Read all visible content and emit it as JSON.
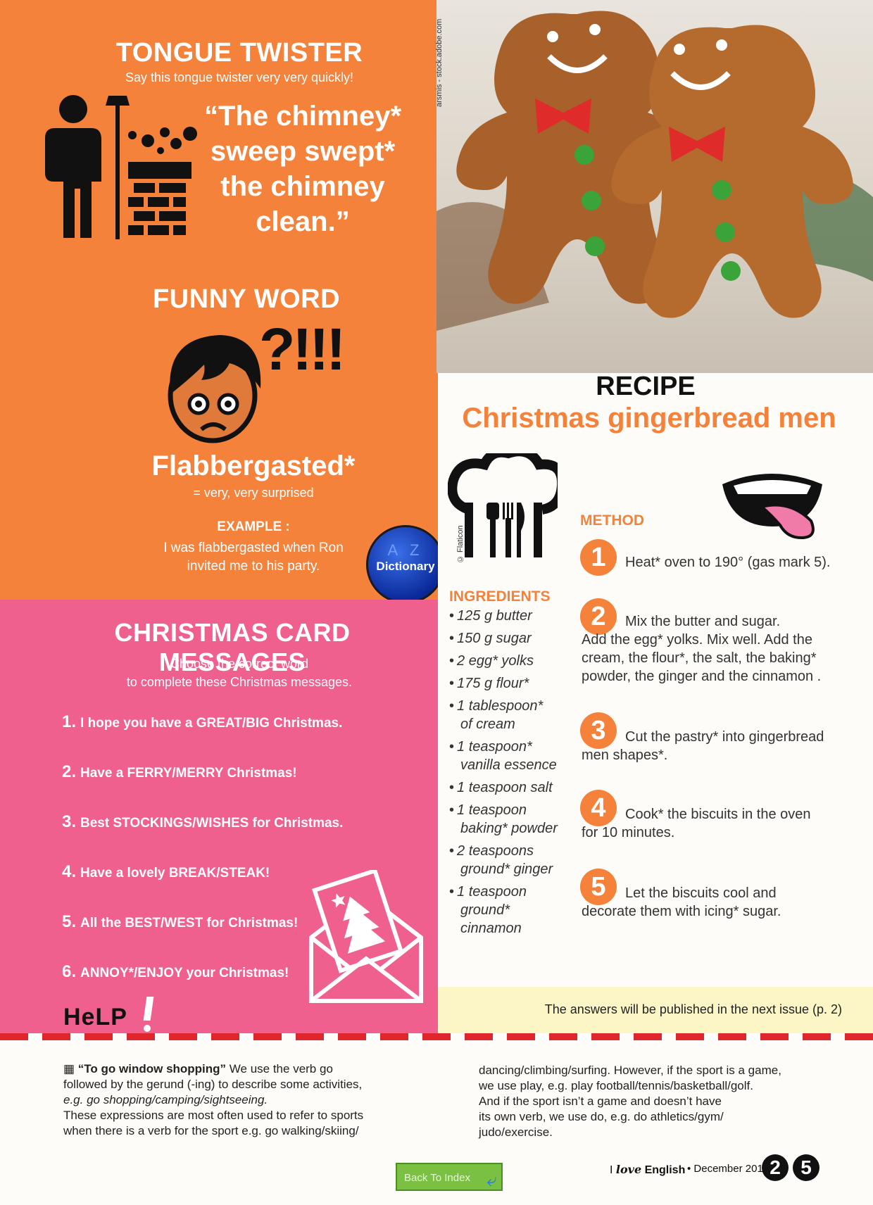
{
  "tongue_twister": {
    "title": "TONGUE TWISTER",
    "subtitle": "Say this tongue twister very very quickly!",
    "lines": [
      "“The chimney*",
      "sweep swept*",
      "the chimney",
      "clean.”"
    ]
  },
  "funny_word": {
    "title": "FUNNY WORD",
    "exclaim": "?!!!",
    "word": "Flabbergasted*",
    "meaning": "= very, very surprised",
    "example_label": "EXAMPLE :",
    "example_lines": [
      "I was flabbergasted when Ron",
      "invited me to his party."
    ]
  },
  "dictionary_badge": {
    "label": "Dictionary",
    "letters": "A Z"
  },
  "photo_credit": "arsmis - stock.adobe.com",
  "card_messages": {
    "title": "CHRISTMAS CARD MESSAGES",
    "instructions": [
      "Choose the correct word",
      "to complete these Christmas messages."
    ],
    "items": [
      {
        "num": "1.",
        "text": "I hope you have a GREAT/BIG Christmas."
      },
      {
        "num": "2.",
        "text": "Have a FERRY/MERRY Christmas!"
      },
      {
        "num": "3.",
        "text": "Best STOCKINGS/WISHES for Christmas."
      },
      {
        "num": "4.",
        "text": "Have a lovely BREAK/STEAK!"
      },
      {
        "num": "5.",
        "text": "All the BEST/WEST for Christmas!"
      },
      {
        "num": "6.",
        "text": "ANNOY*/ENJOY your Christmas!"
      }
    ]
  },
  "help_logo": "HeLP",
  "recipe": {
    "label": "RECIPE",
    "title": "Christmas gingerbread men",
    "icon_credit": "© Flaticon",
    "ingredients_label": "INGREDIENTS",
    "ingredients": [
      [
        "125 g butter"
      ],
      [
        "150 g sugar"
      ],
      [
        "2 egg* yolks"
      ],
      [
        "175 g flour*"
      ],
      [
        "1 tablespoon*",
        "of cream"
      ],
      [
        "1 teaspoon*",
        "vanilla essence"
      ],
      [
        "1 teaspoon salt"
      ],
      [
        "1 teaspoon",
        "baking* powder"
      ],
      [
        "2 teaspoons",
        "ground* ginger"
      ],
      [
        "1 teaspoon",
        "ground*",
        "cinnamon"
      ]
    ],
    "method_label": "METHOD",
    "steps": [
      {
        "num": "1",
        "lines": [
          "Heat* oven to 190° (gas mark 5)."
        ]
      },
      {
        "num": "2",
        "lines": [
          "Mix the butter and sugar.",
          "Add the egg* yolks. Mix well. Add the",
          "cream, the flour*, the salt, the baking*",
          "powder, the ginger and the cinnamon ."
        ]
      },
      {
        "num": "3",
        "lines": [
          "Cut the pastry* into gingerbread",
          "men shapes*."
        ]
      },
      {
        "num": "4",
        "lines": [
          "Cook* the biscuits in the oven",
          "for 10 minutes."
        ]
      },
      {
        "num": "5",
        "lines": [
          "Let the biscuits cool and",
          "decorate them with icing* sugar."
        ]
      }
    ]
  },
  "answers_note": "The answers will be published in the next issue (p. 2)",
  "help_box": {
    "left_heading": "“To go window shopping”",
    "left_lines": [
      " We use the verb go",
      "followed by the gerund (-ing) to describe some activities,",
      "e.g. go shopping/camping/sightseeing.",
      "These expressions are most often used to refer to sports",
      "when there is a verb for the sport e.g. go walking/skiing/"
    ],
    "right_lines": [
      "dancing/climbing/surfing. However, if the sport is a game,",
      "we use play, e.g. play football/tennis/basketball/golf.",
      "And if the sport isn’t a game and doesn’t have",
      "its own verb, we use do, e.g. do athletics/gym/",
      "judo/exercise."
    ]
  },
  "footer": {
    "back_button": "Back To Index",
    "magazine_prefix": "I ",
    "magazine_love": "love",
    "magazine_suffix": " English",
    "issue": "• December 2017",
    "page_digits": [
      "2",
      "5"
    ]
  },
  "colors": {
    "orange": "#f4823a",
    "pink": "#f0608f",
    "dash_red": "#e0262d",
    "answers_band": "#fcf6c6"
  }
}
